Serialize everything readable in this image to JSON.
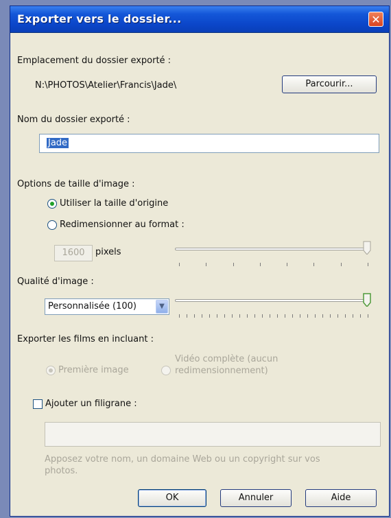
{
  "window": {
    "title": "Exporter vers le dossier...",
    "close_glyph": "✕"
  },
  "location": {
    "label": "Emplacement du dossier exporté :",
    "path": "N:\\PHOTOS\\Atelier\\Francis\\Jade\\",
    "browse_button": "Parcourir..."
  },
  "folder_name": {
    "label": "Nom du dossier exporté :",
    "value": "Jade"
  },
  "size_options": {
    "label": "Options de taille d'image :",
    "original_label": "Utiliser la taille d'origine",
    "original_selected": true,
    "resize_label": "Redimensionner au format :",
    "resize_selected": false,
    "pixels_value": "1600",
    "pixels_unit": "pixels",
    "slider_level": 1.0
  },
  "quality": {
    "label": "Qualité d'image :",
    "selected": "Personnalisée (100)",
    "slider_level": 1.0
  },
  "movies": {
    "label": "Exporter les films en incluant :",
    "first_image_label": "Première image",
    "full_video_label_line1": "Vidéo complète (aucun",
    "full_video_label_line2": "redimensionnement)"
  },
  "watermark": {
    "checkbox_label": "Ajouter un filigrane :",
    "checked": false,
    "text_value": "",
    "hint_line1": "Apposez votre nom, un domaine Web ou un copyright sur vos",
    "hint_line2": "photos."
  },
  "buttons": {
    "ok": "OK",
    "cancel": "Annuler",
    "help": "Aide"
  },
  "colors": {
    "title_bar": "#0b46c9",
    "dialog_bg": "#ece9d8",
    "selection": "#316ac5"
  }
}
